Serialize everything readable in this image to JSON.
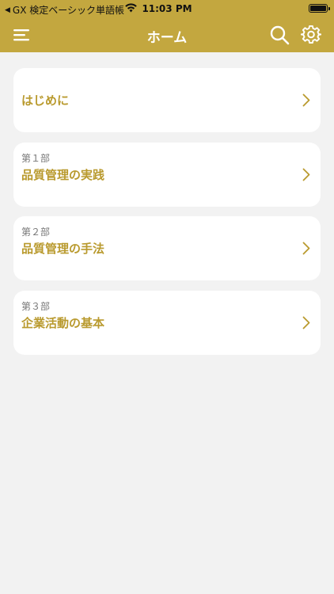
{
  "status_bar": {
    "back_app": "GX 検定ベーシック単語帳",
    "time": "11:03 PM"
  },
  "nav": {
    "title": "ホーム"
  },
  "icons": {
    "menu": "menu-icon",
    "search": "search-icon",
    "settings": "gear-icon",
    "chevron": "chevron-right-icon"
  },
  "colors": {
    "bar": "#c3a73f",
    "accent_text": "#b99a2e",
    "background": "#f2f2f2"
  },
  "sections": [
    {
      "subtitle": "",
      "title": "はじめに"
    },
    {
      "subtitle": "第１部",
      "title": "品質管理の実践"
    },
    {
      "subtitle": "第２部",
      "title": "品質管理の手法"
    },
    {
      "subtitle": "第３部",
      "title": "企業活動の基本"
    }
  ]
}
